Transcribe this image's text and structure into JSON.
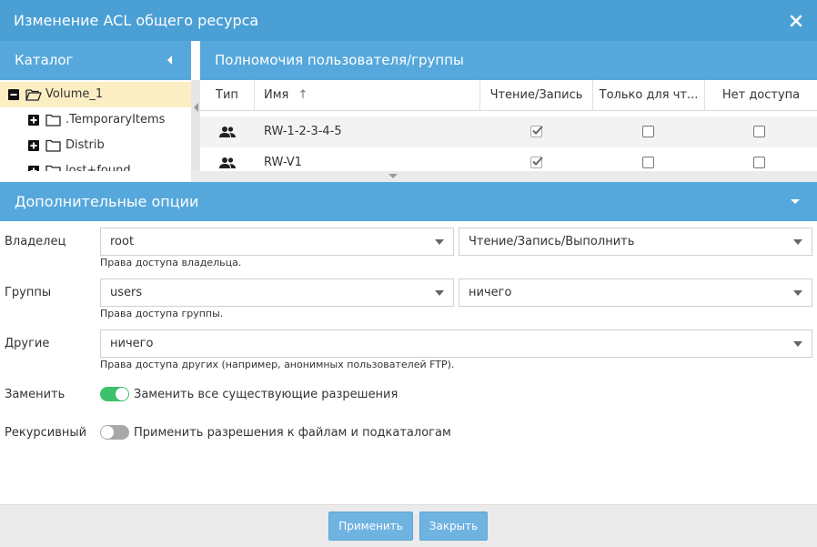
{
  "dialog": {
    "title": "Изменение ACL общего ресурса",
    "close_icon": "close-icon"
  },
  "catalog": {
    "header": "Каталог",
    "items": [
      {
        "name": "Volume_1",
        "state": "minus",
        "selected": true
      },
      {
        "name": ".TemporaryItems",
        "state": "plus",
        "selected": false
      },
      {
        "name": "Distrib",
        "state": "plus",
        "selected": false
      },
      {
        "name": "lost+found",
        "state": "plus",
        "selected": false
      }
    ]
  },
  "permissions": {
    "header": "Полномочия пользователя/группы",
    "columns": [
      "Тип",
      "Имя",
      "Чтение/Запись",
      "Только для чт...",
      "Нет доступа"
    ],
    "sort_indicator": "↑",
    "rows": [
      {
        "type_icon": "group-icon",
        "name": "RW-1-2-3-4-5",
        "read_write": true,
        "read_only": false,
        "no_access": false
      },
      {
        "type_icon": "group-icon",
        "name": "RW-V1",
        "read_write": true,
        "read_only": false,
        "no_access": false
      }
    ]
  },
  "options": {
    "header": "Дополнительные опции",
    "owner": {
      "label": "Владелец",
      "user": "root",
      "permission": "Чтение/Запись/Выполнить",
      "hint": "Права доступа владельца."
    },
    "group": {
      "label": "Группы",
      "user": "users",
      "permission": "ничего",
      "hint": "Права доступа группы."
    },
    "others": {
      "label": "Другие",
      "permission": "ничего",
      "hint": "Права доступа других (например, анонимных пользователей FTP)."
    },
    "replace": {
      "label": "Заменить",
      "text": "Заменить все существующие разрешения",
      "on": true
    },
    "recursive": {
      "label": "Рекурсивный",
      "text": "Применить разрешения к файлам и подкаталогам",
      "on": false
    }
  },
  "footer": {
    "apply": "Применить",
    "close": "Закрыть"
  },
  "colors": {
    "titlebar": "#4a9fd5",
    "panel_header": "#56a8dc",
    "toggle_on": "#3cc26a",
    "button": "#6fb3e0"
  }
}
